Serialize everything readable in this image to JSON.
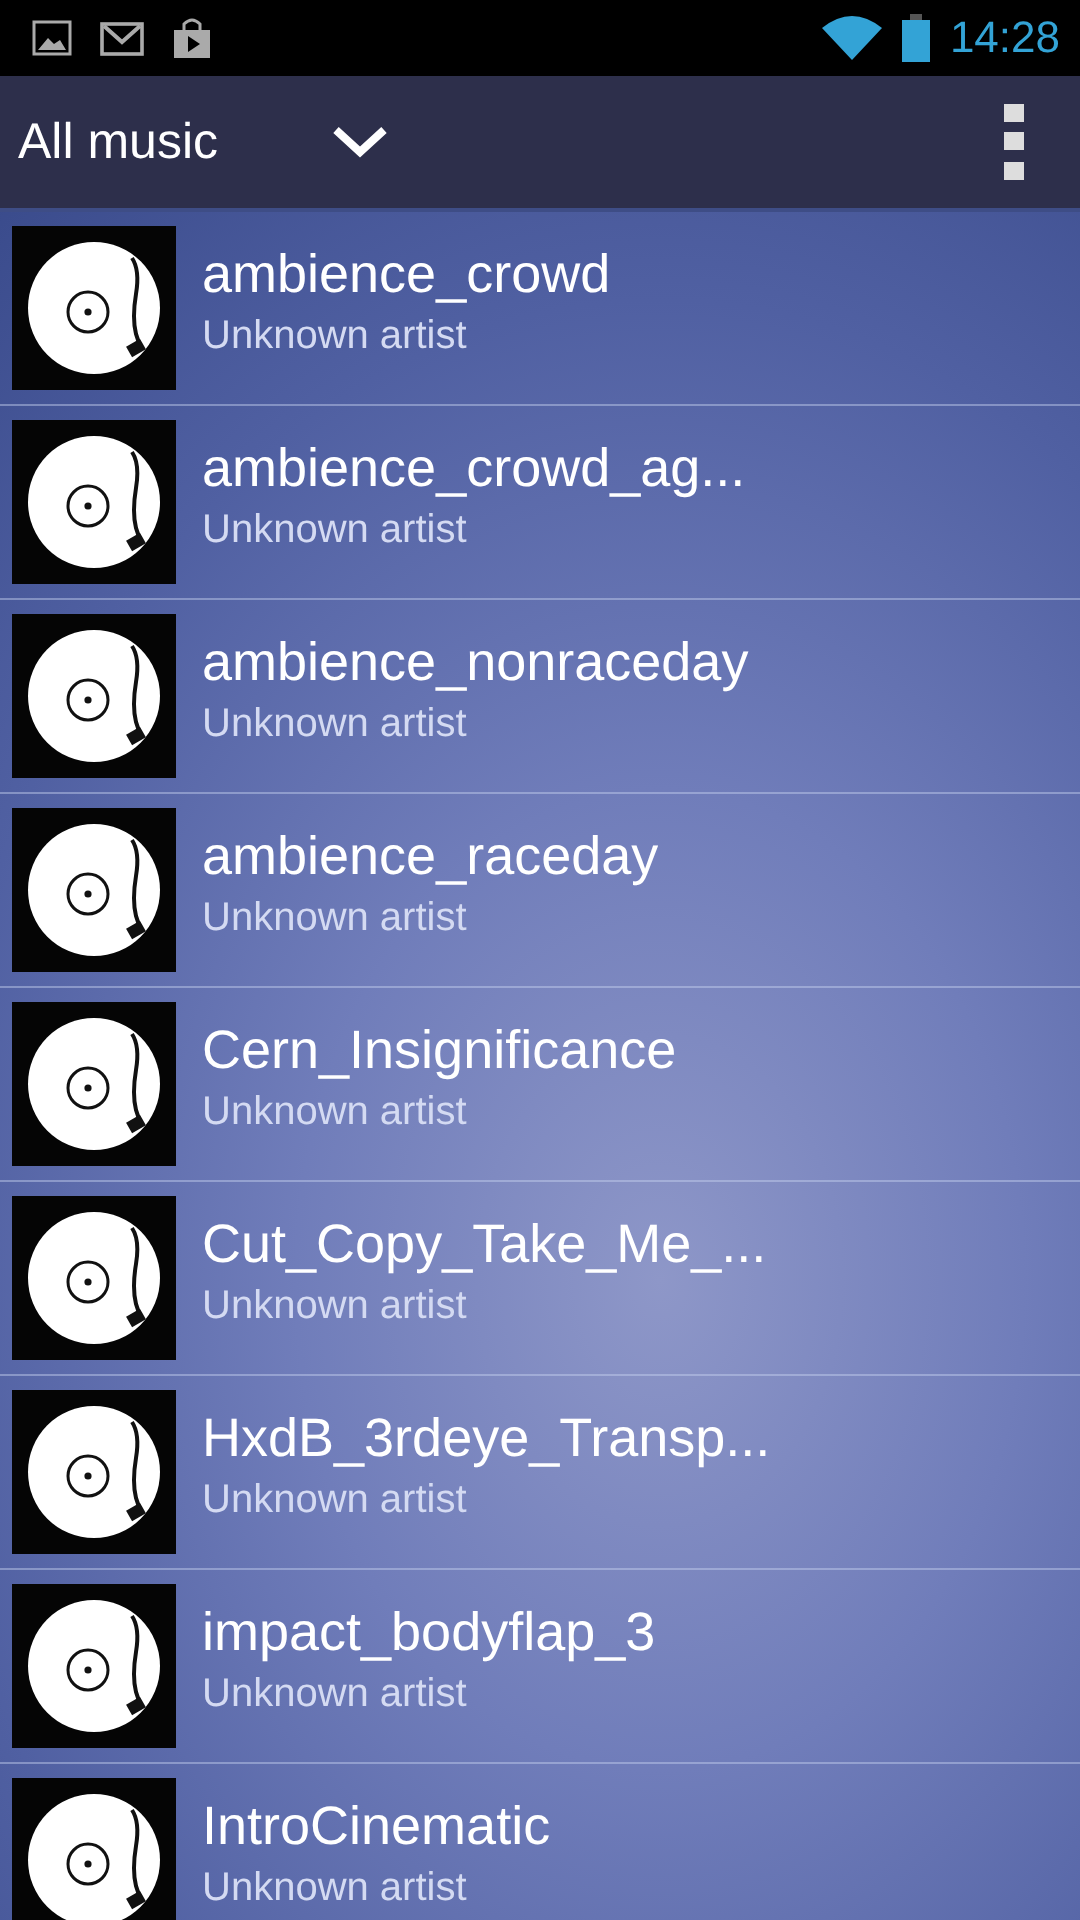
{
  "status_bar": {
    "time": "14:28"
  },
  "action_bar": {
    "title": "All music"
  },
  "songs": [
    {
      "title": "ambience_crowd",
      "artist": "Unknown artist"
    },
    {
      "title": "ambience_crowd_ag...",
      "artist": "Unknown artist"
    },
    {
      "title": "ambience_nonraceday",
      "artist": "Unknown artist"
    },
    {
      "title": "ambience_raceday",
      "artist": "Unknown artist"
    },
    {
      "title": "Cern_Insignificance",
      "artist": "Unknown artist"
    },
    {
      "title": "Cut_Copy_Take_Me_...",
      "artist": "Unknown artist"
    },
    {
      "title": "HxdB_3rdeye_Transp...",
      "artist": "Unknown artist"
    },
    {
      "title": "impact_bodyflap_3",
      "artist": "Unknown artist"
    },
    {
      "title": "IntroCinematic",
      "artist": "Unknown artist"
    }
  ]
}
